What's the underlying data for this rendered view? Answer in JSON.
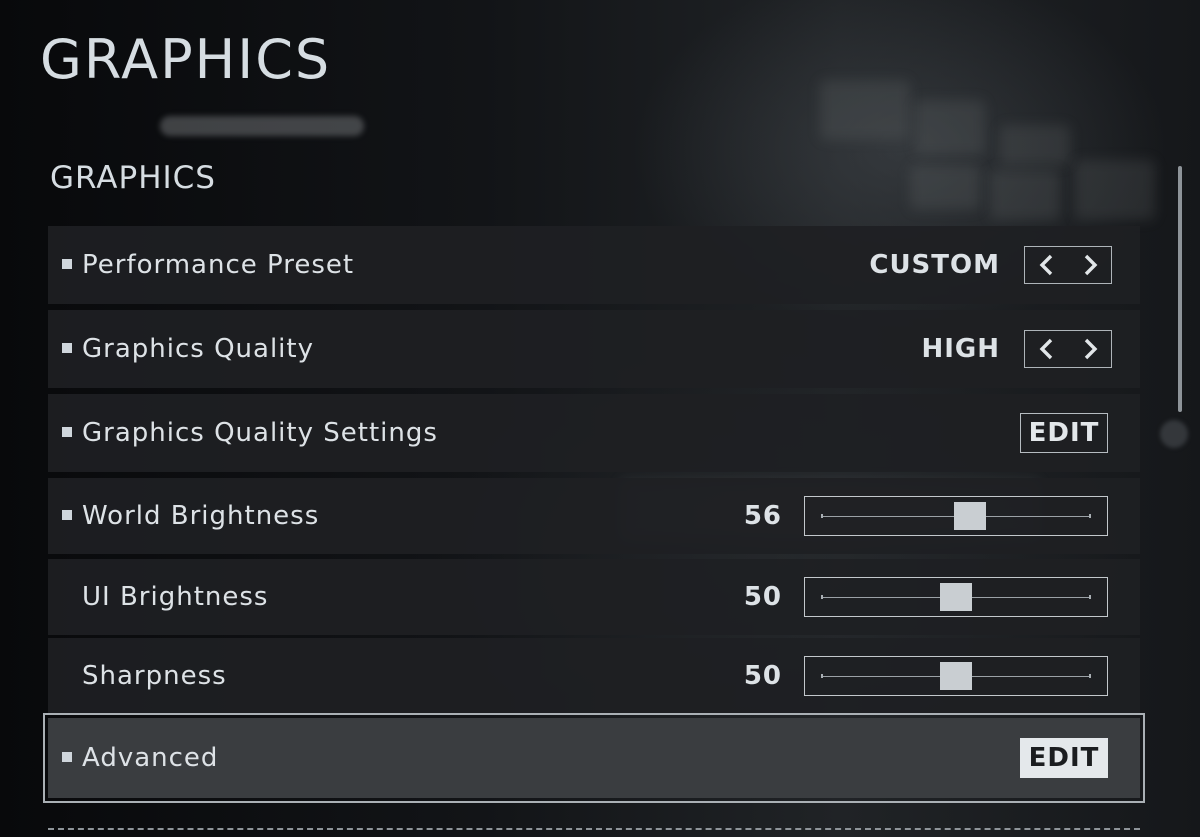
{
  "header": {
    "title": "GRAPHICS"
  },
  "section": {
    "title": "GRAPHICS"
  },
  "settings": [
    {
      "label": "Performance Preset",
      "type": "selector",
      "value": "CUSTOM",
      "bullet": true
    },
    {
      "label": "Graphics Quality",
      "type": "selector",
      "value": "HIGH",
      "bullet": true
    },
    {
      "label": "Graphics Quality Settings",
      "type": "edit",
      "button": "EDIT",
      "bullet": true
    },
    {
      "label": "World Brightness",
      "type": "slider",
      "value": "56",
      "fraction": 0.56,
      "bullet": true
    },
    {
      "label": "UI Brightness",
      "type": "slider",
      "value": "50",
      "fraction": 0.5,
      "bullet": false
    },
    {
      "label": "Sharpness",
      "type": "slider",
      "value": "50",
      "fraction": 0.5,
      "bullet": false
    },
    {
      "label": "Advanced",
      "type": "edit",
      "button": "EDIT",
      "bullet": true,
      "selected": true
    }
  ],
  "icons": {
    "prev": "chevron-left-icon",
    "next": "chevron-right-icon"
  },
  "colors": {
    "text": "#d8dde2",
    "row_bg": "#1e2023",
    "selected_row_bg": "#3a3d40",
    "selected_button_bg": "#e4e8eb"
  }
}
